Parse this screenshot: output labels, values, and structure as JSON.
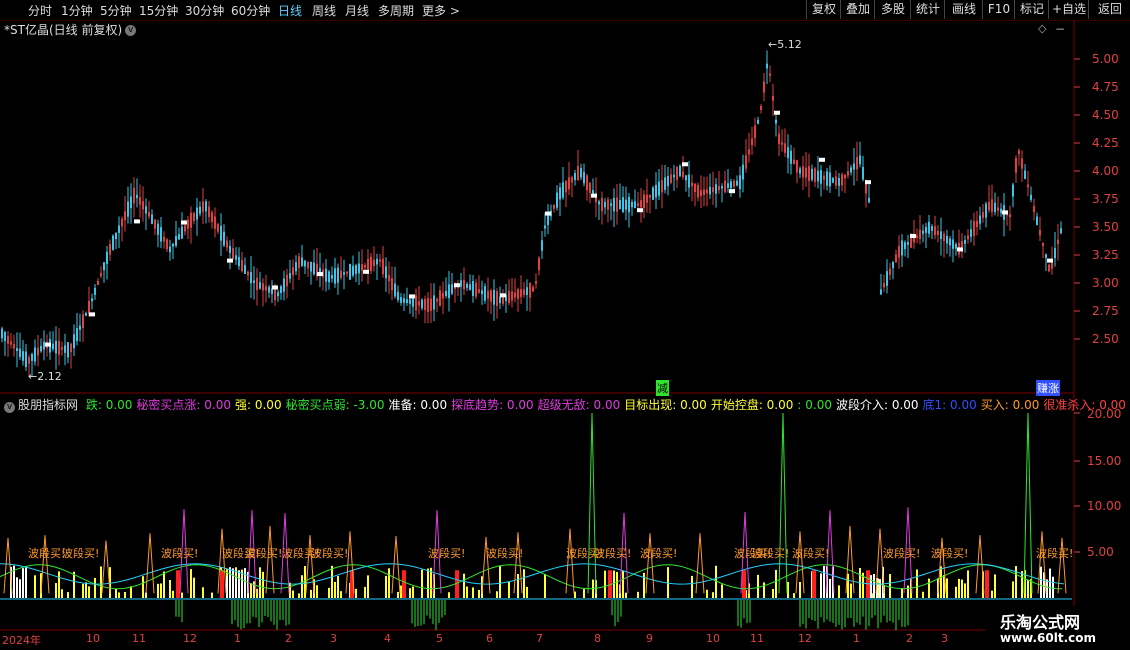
{
  "periods": [
    {
      "label": "分时",
      "active": false
    },
    {
      "label": "1分钟",
      "active": false
    },
    {
      "label": "5分钟",
      "active": false
    },
    {
      "label": "15分钟",
      "active": false
    },
    {
      "label": "30分钟",
      "active": false
    },
    {
      "label": "60分钟",
      "active": false
    },
    {
      "label": "日线",
      "active": true
    },
    {
      "label": "周线",
      "active": false
    },
    {
      "label": "月线",
      "active": false
    },
    {
      "label": "多周期",
      "active": false
    },
    {
      "label": "更多 >",
      "active": false
    }
  ],
  "toolbar": [
    "复权",
    "叠加",
    "多股",
    "统计",
    "画线",
    "F10",
    "标记",
    "+自选",
    "返回"
  ],
  "chart_title": "*ST亿晶(日线 前复权)",
  "price_axis": [
    "5.00",
    "4.75",
    "4.50",
    "4.25",
    "4.00",
    "3.75",
    "3.50",
    "3.25",
    "3.00",
    "2.75",
    "2.50"
  ],
  "price_high_label": "5.12",
  "price_low_label": "2.12",
  "marker_labels": {
    "reduce": "减",
    "buy_sign": "赚涨"
  },
  "indicator": {
    "name": "股朋指标网",
    "items": [
      {
        "label": "跌: 0.00",
        "color": "#2ee62e"
      },
      {
        "label": "秘密买点涨: 0.00",
        "color": "#e03be0"
      },
      {
        "label": "强: 0.00",
        "color": "#ffff33"
      },
      {
        "label": "秘密买点弱: -3.00",
        "color": "#2ee62e"
      },
      {
        "label": "准备: 0.00",
        "color": "#ffffff"
      },
      {
        "label": "探底趋势: 0.00",
        "color": "#e03be0"
      },
      {
        "label": "超级无敌: 0.00",
        "color": "#e03be0"
      },
      {
        "label": "目标出现: 0.00",
        "color": "#ffff33"
      },
      {
        "label": "开始控盘: 0.00",
        "color": "#ffff33"
      },
      {
        "label": ": 0.00",
        "color": "#2ee62e"
      },
      {
        "label": "波段介入: 0.00",
        "color": "#ffffff"
      },
      {
        "label": "底1: 0.00",
        "color": "#3050ff"
      },
      {
        "label": "买入: 0.00",
        "color": "#ff9a2a"
      },
      {
        "label": "很准杀入: 0.00",
        "color": "#ff4040"
      }
    ]
  },
  "indicator_axis": [
    "20.00",
    "15.00",
    "10.00",
    "5.00"
  ],
  "wave_buy_label": "波段买!",
  "dates": [
    "2024年",
    "10",
    "11",
    "12",
    "1",
    "2",
    "3",
    "4",
    "5",
    "6",
    "7",
    "8",
    "9",
    "10",
    "11",
    "12",
    "1",
    "2",
    "3"
  ],
  "watermark": {
    "line1": "乐淘公式网",
    "line2": "www.60lt.com"
  },
  "colors": {
    "up": "#e04040",
    "down": "#39c6e8",
    "axis": "#e04040",
    "frame": "#7a0000"
  }
}
